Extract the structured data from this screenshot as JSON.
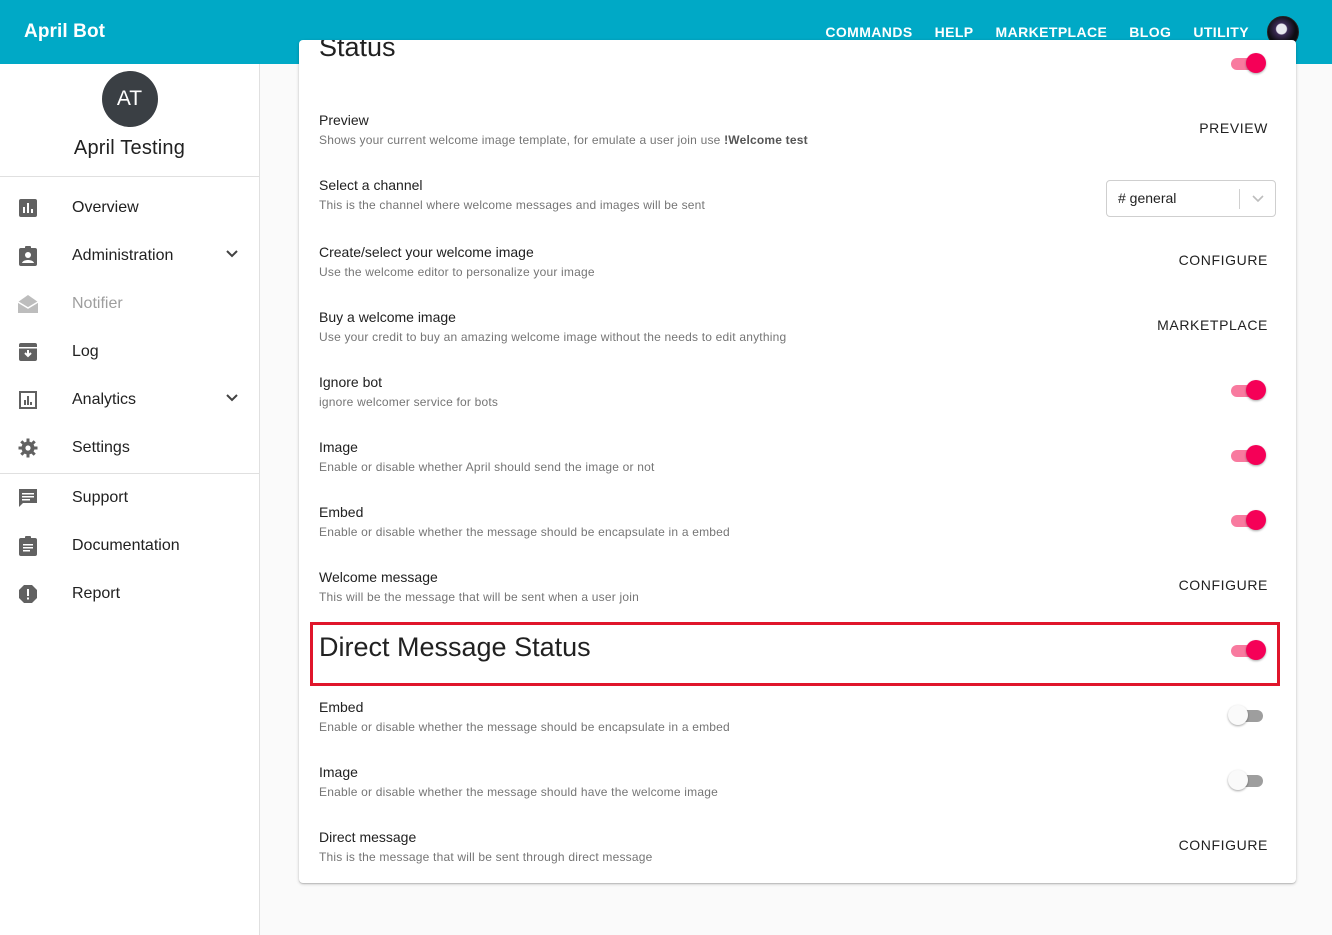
{
  "topbar": {
    "brand": "April Bot",
    "nav": [
      "COMMANDS",
      "HELP",
      "MARKETPLACE",
      "BLOG",
      "UTILITY"
    ],
    "color": "#00a9c6"
  },
  "sidebar": {
    "avatar_initials": "AT",
    "user_name": "April Testing",
    "items": [
      {
        "label": "Overview",
        "icon": "bar-chart-icon"
      },
      {
        "label": "Administration",
        "icon": "badge-icon",
        "expandable": true
      },
      {
        "label": "Notifier",
        "icon": "drafts-icon",
        "disabled": true
      },
      {
        "label": "Log",
        "icon": "archive-icon"
      },
      {
        "label": "Analytics",
        "icon": "analytics-icon",
        "expandable": true
      },
      {
        "label": "Settings",
        "icon": "gear-icon"
      },
      {
        "label": "Support",
        "icon": "chat-icon"
      },
      {
        "label": "Documentation",
        "icon": "clipboard-icon"
      },
      {
        "label": "Report",
        "icon": "alert-icon"
      }
    ]
  },
  "main": {
    "partial_header": "Status",
    "rows": [
      {
        "title": "Preview",
        "desc": "Shows your current welcome image template, for emulate a user join use ",
        "desc_bold": "!Welcome test",
        "action": "PREVIEW"
      },
      {
        "title": "Select a channel",
        "desc": "This is the channel where welcome messages and images will be sent",
        "select_value": "# general"
      },
      {
        "title": "Create/select your welcome image",
        "desc": "Use the welcome editor to personalize your image",
        "action": "CONFIGURE"
      },
      {
        "title": "Buy a welcome image",
        "desc": "Use your credit to buy an amazing welcome image without the needs to edit anything",
        "action": "MARKETPLACE"
      },
      {
        "title": "Ignore bot",
        "desc": "ignore welcomer service for bots",
        "toggle": true
      },
      {
        "title": "Image",
        "desc": "Enable or disable whether April should send the image or not",
        "toggle": true
      },
      {
        "title": "Embed",
        "desc": "Enable or disable whether the message should be encapsulate in a embed",
        "toggle": true
      },
      {
        "title": "Welcome message",
        "desc": "This will be the message that will be sent when a user join",
        "action": "CONFIGURE"
      }
    ],
    "dm_section": {
      "title": "Direct Message Status",
      "toggle": true,
      "rows": [
        {
          "title": "Embed",
          "desc": "Enable or disable whether the message should be encapsulate in a embed",
          "toggle": false
        },
        {
          "title": "Image",
          "desc": "Enable or disable whether the message should have the welcome image",
          "toggle": false
        },
        {
          "title": "Direct message",
          "desc": "This is the message that will be sent through direct message",
          "action": "CONFIGURE"
        }
      ]
    },
    "accent_color": "#f50057",
    "highlight_color": "#e0162b"
  }
}
